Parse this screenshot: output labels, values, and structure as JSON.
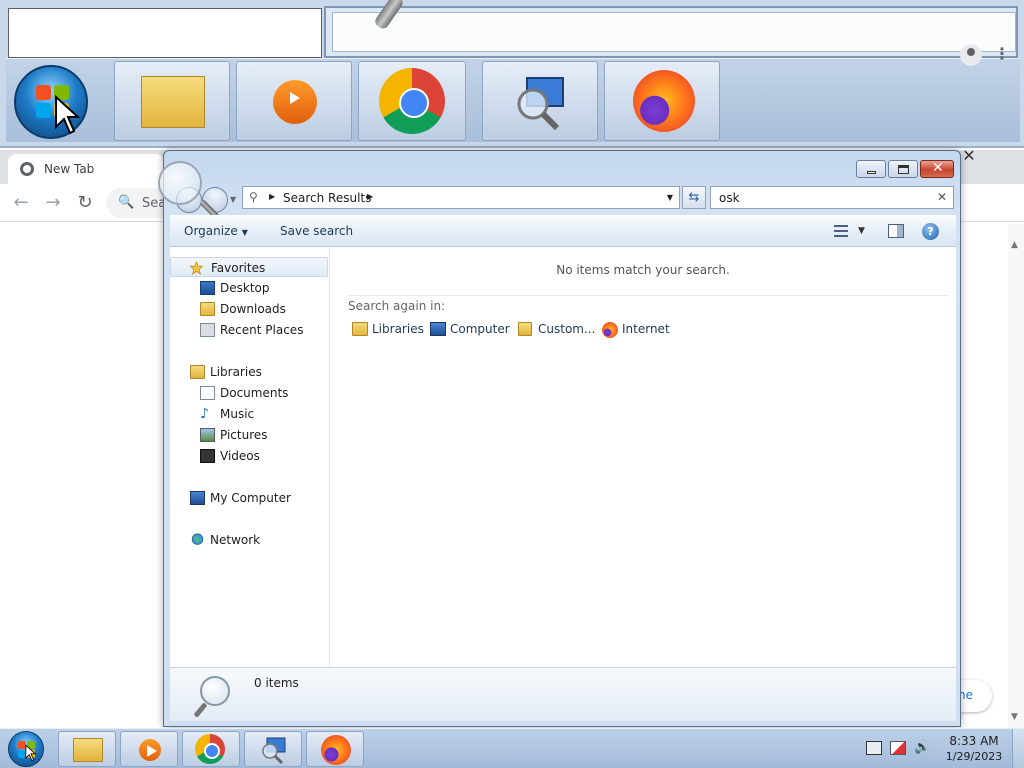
{
  "chrome": {
    "tab_title": "New Tab",
    "omnibox_text": "Sea",
    "customize_label": "ne"
  },
  "explorer": {
    "breadcrumb": "Search Results",
    "search_value": "osk",
    "toolbar": {
      "organize": "Organize",
      "save_search": "Save search"
    },
    "nav": {
      "favorites": "Favorites",
      "desktop": "Desktop",
      "downloads": "Downloads",
      "recent_places": "Recent Places",
      "libraries": "Libraries",
      "documents": "Documents",
      "music": "Music",
      "pictures": "Pictures",
      "videos": "Videos",
      "my_computer": "My Computer",
      "network": "Network"
    },
    "content": {
      "no_items": "No items match your search.",
      "search_again": "Search again in:",
      "locations": [
        "Libraries",
        "Computer",
        "Custom...",
        "Internet"
      ]
    },
    "status": "0 items"
  },
  "taskbar": {
    "time": "8:33 AM",
    "date": "1/29/2023"
  },
  "colors": {
    "taskbar": "#a3bbd8",
    "window_frame": "#c2d6ee",
    "close_button": "#c7462f",
    "link_blue": "#1a73e8"
  }
}
